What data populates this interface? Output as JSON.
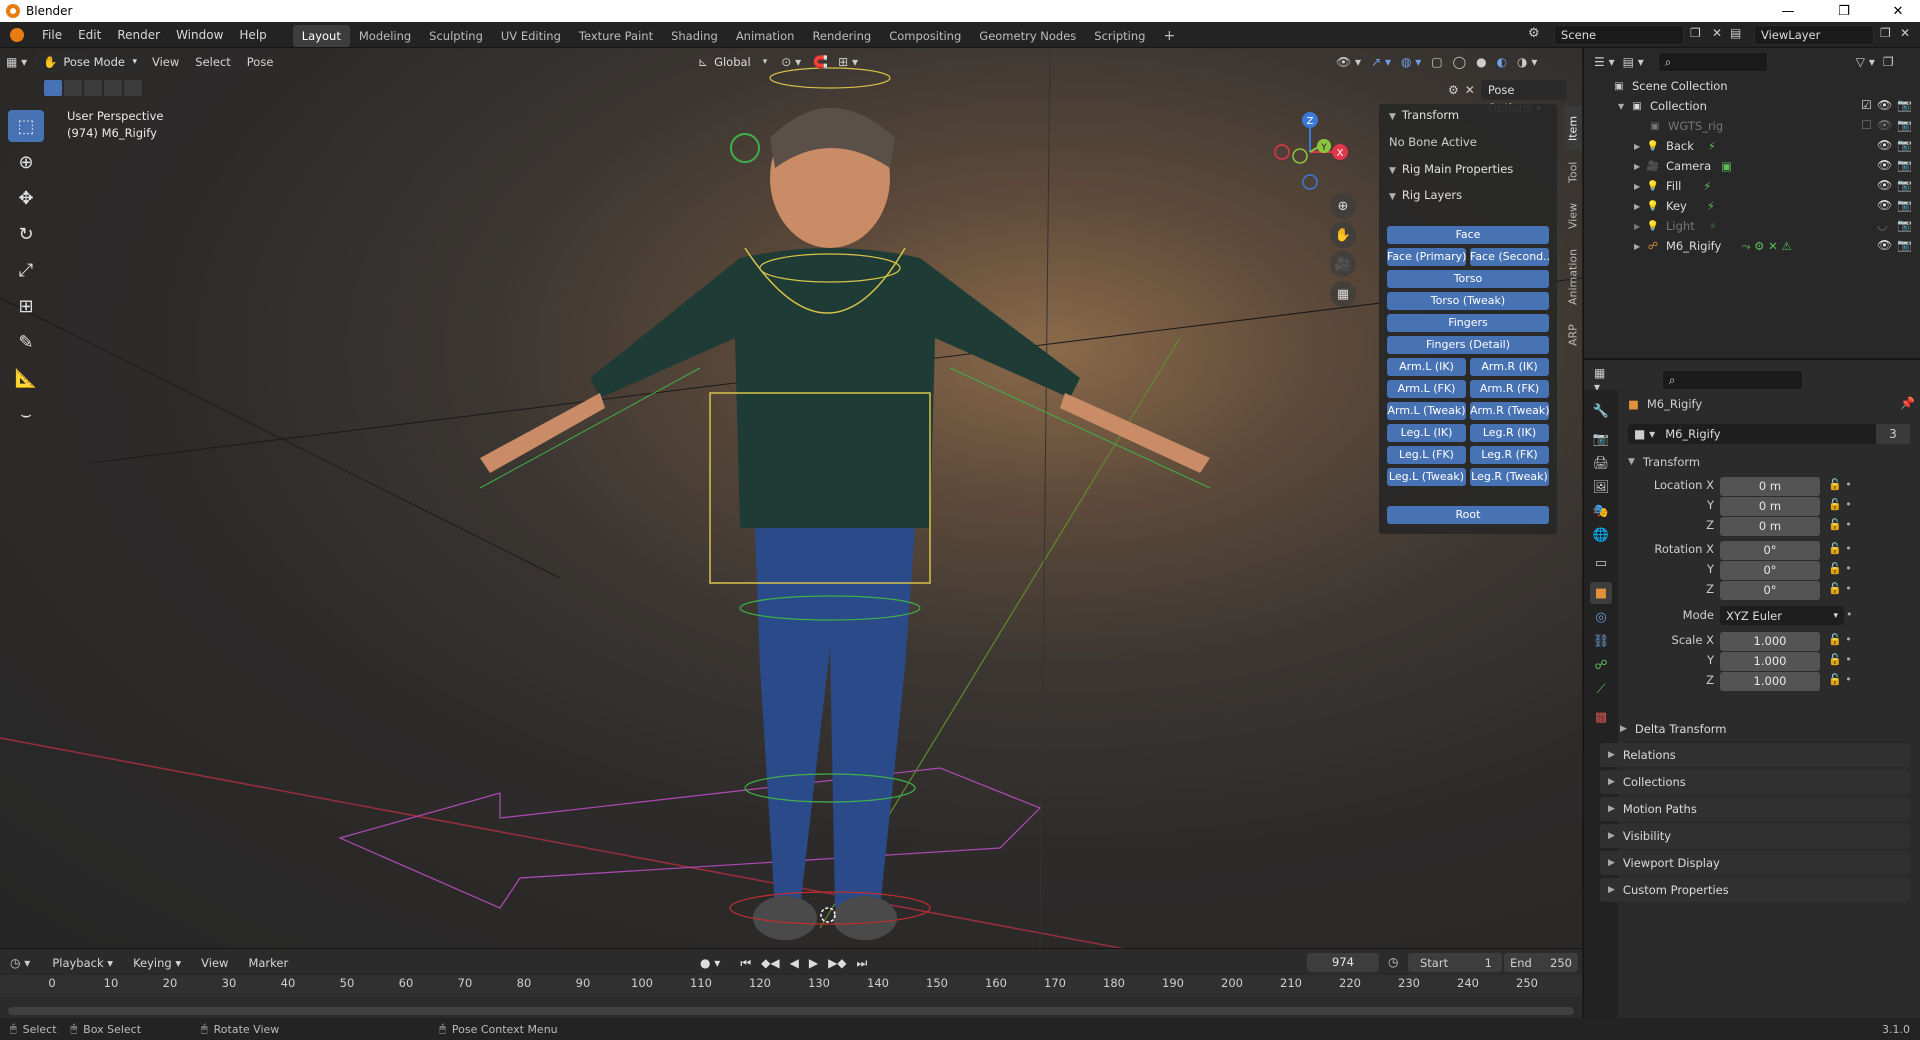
{
  "window": {
    "title": "Blender",
    "controls": [
      "—",
      "❐",
      "✕"
    ]
  },
  "menu": {
    "items": [
      "File",
      "Edit",
      "Render",
      "Window",
      "Help"
    ],
    "workspaces": [
      "Layout",
      "Modeling",
      "Sculpting",
      "UV Editing",
      "Texture Paint",
      "Shading",
      "Animation",
      "Rendering",
      "Compositing",
      "Geometry Nodes",
      "Scripting"
    ],
    "active_workspace": "Layout",
    "add_tab": "+",
    "scene": "Scene",
    "view_layer": "ViewLayer"
  },
  "viewport": {
    "mode": "Pose Mode",
    "menus": [
      "View",
      "Select",
      "Pose"
    ],
    "orientation": "Global",
    "perspective": "User Perspective",
    "object_info": "(974) M6_Rigify",
    "pose_options": "Pose Options",
    "gizmo": {
      "x": "X",
      "y": "Y",
      "z": "Z"
    }
  },
  "tools": [
    "select-box",
    "cursor",
    "move",
    "rotate",
    "scale",
    "transform",
    "annotate",
    "measure",
    "bone-size"
  ],
  "npanel": {
    "tabs": [
      "Item",
      "Tool",
      "View",
      "Animation",
      "ARP"
    ],
    "transform_label": "Transform",
    "no_bone": "No Bone Active",
    "rig_main": "Rig Main Properties",
    "rig_layers": "Rig Layers",
    "buttons": {
      "face": "Face",
      "face_primary": "Face (Primary)",
      "face_secondary": "Face (Second...",
      "torso": "Torso",
      "torso_tweak": "Torso (Tweak)",
      "fingers": "Fingers",
      "fingers_detail": "Fingers (Detail)",
      "arm_l_ik": "Arm.L (IK)",
      "arm_r_ik": "Arm.R (IK)",
      "arm_l_fk": "Arm.L (FK)",
      "arm_r_fk": "Arm.R (FK)",
      "arm_l_tweak": "Arm.L (Tweak)",
      "arm_r_tweak": "Arm.R (Tweak)",
      "leg_l_ik": "Leg.L (IK)",
      "leg_r_ik": "Leg.R (IK)",
      "leg_l_fk": "Leg.L (FK)",
      "leg_r_fk": "Leg.R (FK)",
      "leg_l_tweak": "Leg.L (Tweak)",
      "leg_r_tweak": "Leg.R (Tweak)",
      "root": "Root"
    }
  },
  "outliner": {
    "scene_collection": "Scene Collection",
    "items": [
      {
        "name": "Collection",
        "icon": "collection-icon"
      },
      {
        "name": "WGTS_rig",
        "icon": "collection-icon"
      },
      {
        "name": "Back",
        "icon": "light-icon"
      },
      {
        "name": "Camera",
        "icon": "camera-icon"
      },
      {
        "name": "Fill",
        "icon": "light-icon"
      },
      {
        "name": "Key",
        "icon": "light-icon"
      },
      {
        "name": "Light",
        "icon": "light-icon"
      },
      {
        "name": "M6_Rigify",
        "icon": "armature-icon"
      }
    ]
  },
  "properties": {
    "object_name": "M6_Rigify",
    "data_name": "M6_Rigify",
    "users": "3",
    "transform": "Transform",
    "location_label": "Location X",
    "rotation_label": "Rotation X",
    "scale_label": "Scale X",
    "y": "Y",
    "z": "Z",
    "location": [
      "0 m",
      "0 m",
      "0 m"
    ],
    "rotation": [
      "0°",
      "0°",
      "0°"
    ],
    "mode_label": "Mode",
    "mode": "XYZ Euler",
    "scale": [
      "1.000",
      "1.000",
      "1.000"
    ],
    "sections": [
      "Delta Transform",
      "Relations",
      "Collections",
      "Motion Paths",
      "Visibility",
      "Viewport Display",
      "Custom Properties"
    ]
  },
  "timeline": {
    "menus": [
      "Playback",
      "Keying",
      "View",
      "Marker"
    ],
    "current_frame": "974",
    "start_label": "Start",
    "start": "1",
    "end_label": "End",
    "end": "250",
    "ticks": [
      "0",
      "10",
      "20",
      "30",
      "40",
      "50",
      "60",
      "70",
      "80",
      "90",
      "100",
      "110",
      "120",
      "130",
      "140",
      "150",
      "160",
      "170",
      "180",
      "190",
      "200",
      "210",
      "220",
      "230",
      "240",
      "250"
    ]
  },
  "statusbar": {
    "select": "Select",
    "box_select": "Box Select",
    "rotate_view": "Rotate View",
    "context_menu": "Pose Context Menu",
    "version": "3.1.0"
  },
  "colors": {
    "accent": "#4772b3",
    "x_axis": "#e2374b",
    "y_axis": "#8bc53e",
    "z_axis": "#3c78d8"
  }
}
